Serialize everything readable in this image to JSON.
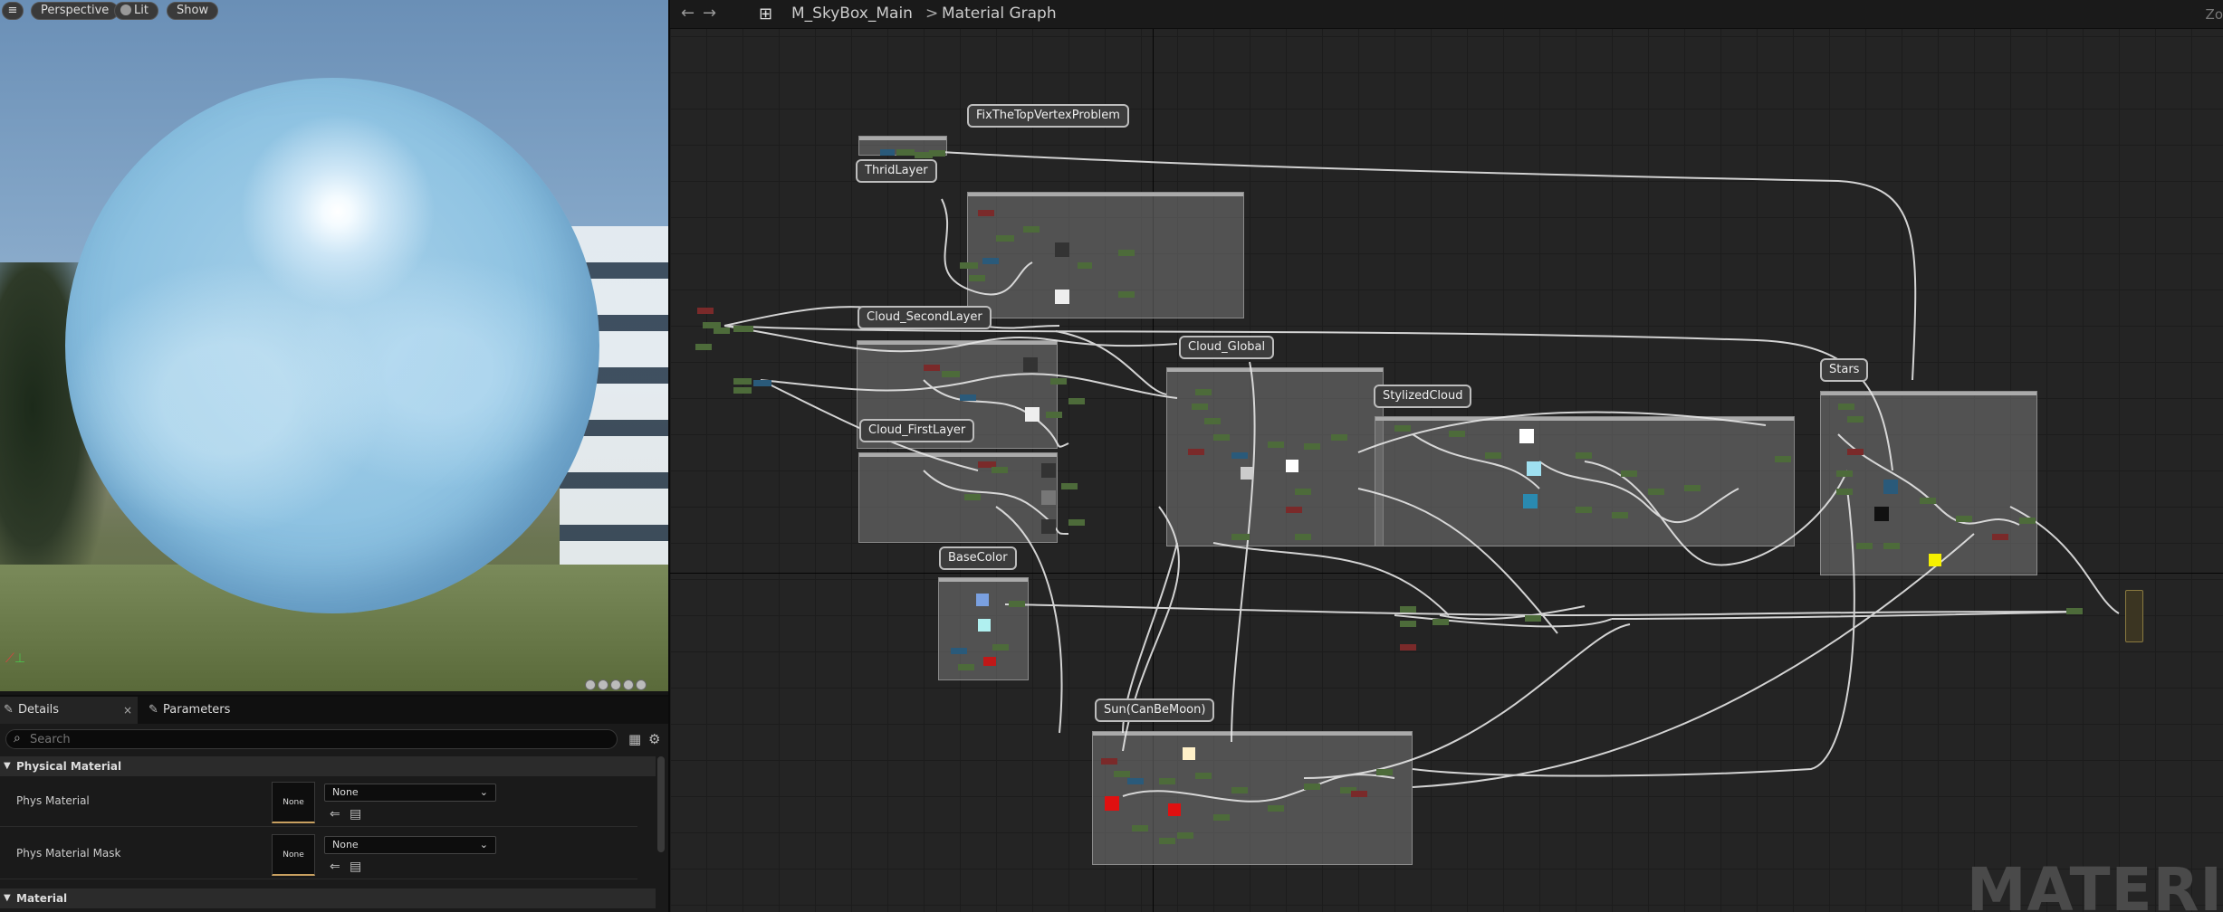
{
  "viewport": {
    "buttons": {
      "menu": "≡",
      "perspective": "Perspective",
      "lit": "Lit",
      "show": "Show"
    }
  },
  "details": {
    "tabs": [
      {
        "label": "Details",
        "close": "×"
      },
      {
        "label": "Parameters"
      }
    ],
    "search_placeholder": "Search",
    "sections": [
      "Physical Material",
      "Material"
    ],
    "properties": [
      {
        "label": "Phys Material",
        "thumb": "None",
        "value": "None"
      },
      {
        "label": "Phys Material Mask",
        "thumb": "None",
        "value": "None"
      }
    ]
  },
  "graph": {
    "breadcrumb": {
      "asset": "M_SkyBox_Main",
      "separator": ">",
      "page": "Material Graph"
    },
    "zoom_label": "Zo",
    "watermark": "MATERI",
    "comments": [
      "FixTheTopVertexProblem",
      "ThridLayer",
      "Cloud_SecondLayer",
      "Cloud_FirstLayer",
      "Cloud_Global",
      "StylizedCloud",
      "Stars",
      "BaseColor",
      "Sun(CanBeMoon)"
    ],
    "colors": {
      "node_green": "#4d6b3a",
      "wire": "#e6e6e6",
      "comment_bg": "#787878",
      "param_blue": "#2a6c8c",
      "param_red": "#8a2222"
    }
  }
}
